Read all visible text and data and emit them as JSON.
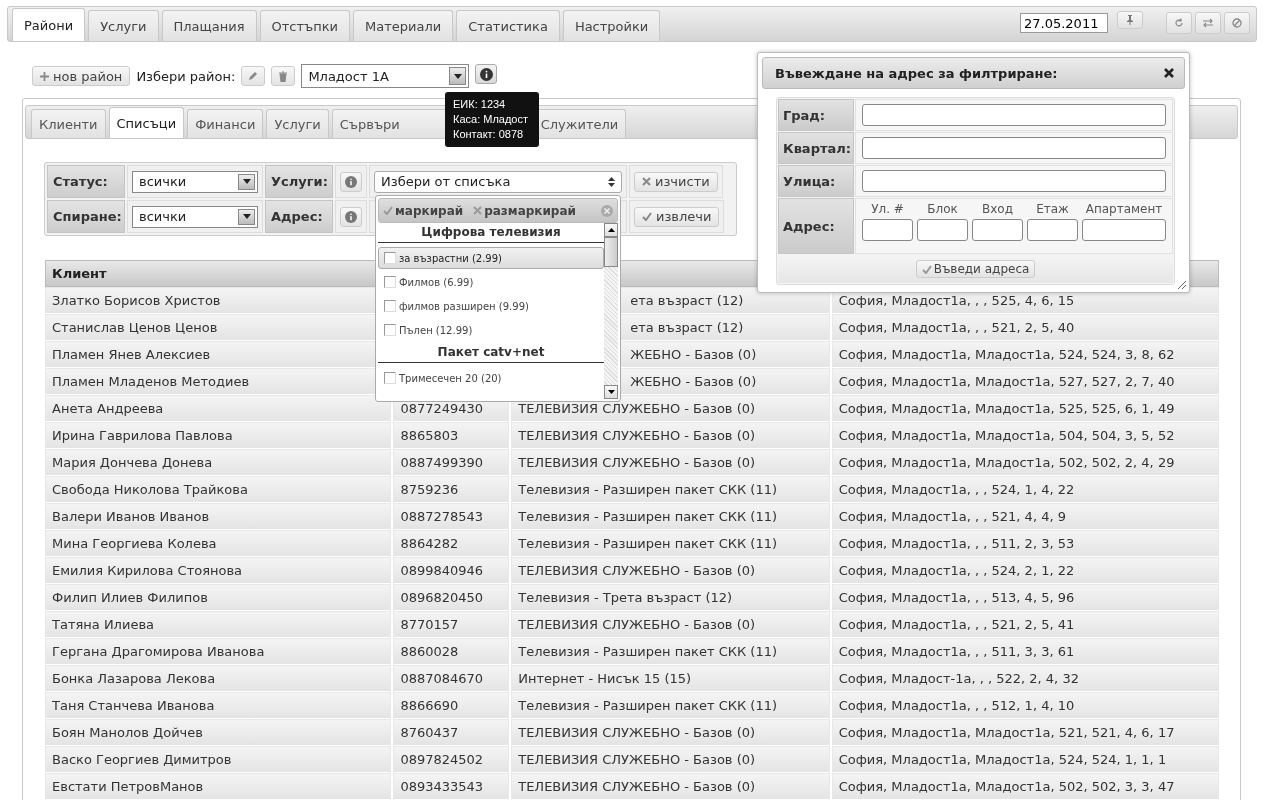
{
  "main_tabs": [
    {
      "label": "Райони",
      "selected": true
    },
    {
      "label": "Услуги",
      "selected": false
    },
    {
      "label": "Плащания",
      "selected": false
    },
    {
      "label": "Отстъпки",
      "selected": false
    },
    {
      "label": "Материали",
      "selected": false
    },
    {
      "label": "Статистика",
      "selected": false
    },
    {
      "label": "Настройки",
      "selected": false
    }
  ],
  "date": "27.05.2011",
  "district_bar": {
    "new_button": "нов район",
    "label": "Избери район:",
    "value": "Младост 1А"
  },
  "tooltip": [
    "ЕИК: 1234",
    "Каса: Младост",
    "Контакт: 0878"
  ],
  "sub_tabs": [
    {
      "label": "Клиенти",
      "selected": false
    },
    {
      "label": "Списъци",
      "selected": true
    },
    {
      "label": "Финанси",
      "selected": false
    },
    {
      "label": "Услуги",
      "selected": false
    },
    {
      "label": "Сървъри",
      "selected": false
    },
    {
      "label": "Служители",
      "selected": false
    }
  ],
  "filters": {
    "status_label": "Статус:",
    "status_value": "всички",
    "stop_label": "Спиране:",
    "stop_value": "всички",
    "services_label": "Услуги:",
    "services_value": "Избери от списъка",
    "address_label": "Адрес:",
    "clear_button": "изчисти",
    "extract_button": "извлечи"
  },
  "services_dropdown": {
    "mark": "маркирай",
    "unmark": "размаркирай",
    "items": [
      {
        "kind": "group",
        "label": "Цифрова телевизия"
      },
      {
        "kind": "option",
        "label": "за възрастни (2.99)",
        "checked": false,
        "focused": true
      },
      {
        "kind": "option",
        "label": "Филмов (6.99)",
        "checked": false,
        "focused": false
      },
      {
        "kind": "option",
        "label": "филмов разширен (9.99)",
        "checked": false,
        "focused": false
      },
      {
        "kind": "option",
        "label": "Пълен (12.99)",
        "checked": false,
        "focused": false
      },
      {
        "kind": "group",
        "label": "Пакет catv+net"
      },
      {
        "kind": "option",
        "label": "Тримесечен 20 (20)",
        "checked": false,
        "focused": false
      }
    ]
  },
  "address_dialog": {
    "title": "Въвеждане на адрес за филтриране:",
    "city_label": "Град:",
    "quarter_label": "Квартал:",
    "street_label": "Улица:",
    "address_label": "Адрес:",
    "parts": [
      "Ул. #",
      "Блок",
      "Вход",
      "Етаж",
      "Апартамент"
    ],
    "submit": "Въведи адреса"
  },
  "table": {
    "columns": [
      "Клиент"
    ],
    "rows": [
      {
        "name": "Златко Борисов Христов",
        "service": "ета възраст (12)",
        "service_cut": true,
        "address": "София, Младост1а, , , 525, 4, 6, 15"
      },
      {
        "name": "Станислав Ценов Ценов",
        "service": "ета възраст (12)",
        "service_cut": true,
        "address": "София, Младост1а, , , 521, 2, 5, 40"
      },
      {
        "name": "Пламен Янев Алексиев",
        "service": "ЖЕБНО - Базов (0)",
        "service_cut": true,
        "address": "София, Младост1а, Младост1а, 524, 524, 3, 8, 62"
      },
      {
        "name": "Пламен Младенов Методиев",
        "service": "ЖЕБНО - Базов (0)",
        "service_cut": true,
        "address": "София, Младост1а, Младост1а, 527, 527, 2, 7, 40"
      },
      {
        "name": "Анета Андреева",
        "phone": "0877249430",
        "service": "ТЕЛЕВИЗИЯ СЛУЖЕБНО - Базов (0)",
        "service_cut": false,
        "address": "София, Младост1а, Младост1а, 525, 525, 6, 1, 49"
      },
      {
        "name": "Ирина Гаврилова Павлова",
        "phone": "8865803",
        "service": "ТЕЛЕВИЗИЯ СЛУЖЕБНО - Базов (0)",
        "service_cut": false,
        "address": "София, Младост1а, Младост1а, 504, 504, 3, 5, 52"
      },
      {
        "name": "Мария Дончева Донева",
        "phone": "0887499390",
        "service": "ТЕЛЕВИЗИЯ СЛУЖЕБНО - Базов (0)",
        "service_cut": false,
        "address": "София, Младост1а, Младост1а, 502, 502, 2, 4, 29"
      },
      {
        "name": "Свобода Николова Трайкова",
        "phone": "8759236",
        "service": "Телевизия - Разширен пакет СКК (11)",
        "service_cut": false,
        "address": "София, Младост1а, , , 524, 1, 4, 22"
      },
      {
        "name": "Валери Иванов Иванов",
        "phone": "0887278543",
        "service": "Телевизия - Разширен пакет СКК (11)",
        "service_cut": false,
        "address": "София, Младост1а, , , 521, 4, 4, 9"
      },
      {
        "name": "Мина Георгиева Колева",
        "phone": "8864282",
        "service": "Телевизия - Разширен пакет СКК (11)",
        "service_cut": false,
        "address": "София, Младост1а, , , 511, 2, 3, 53"
      },
      {
        "name": "Емилия Кирилова Стоянова",
        "phone": "0899840946",
        "service": "ТЕЛЕВИЗИЯ СЛУЖЕБНО - Базов (0)",
        "service_cut": false,
        "address": "София, Младост1а, , , 524, 2, 1, 22"
      },
      {
        "name": "Филип Илиев Филипов",
        "phone": "0896820450",
        "service": "Телевизия - Трета възраст (12)",
        "service_cut": false,
        "address": "София, Младост1а, , , 513, 4, 5, 96"
      },
      {
        "name": "Татяна Илиева",
        "phone": "8770157",
        "service": "ТЕЛЕВИЗИЯ СЛУЖЕБНО - Базов (0)",
        "service_cut": false,
        "address": "София, Младост1а, , , 521, 2, 5, 41"
      },
      {
        "name": "Гергана Драгомирова Иванова",
        "phone": "8860028",
        "service": "Телевизия - Разширен пакет СКК (11)",
        "service_cut": false,
        "address": "София, Младост1а, , , 511, 3, 3, 61"
      },
      {
        "name": "Бонка Лазарова Лекова",
        "phone": "0887084670",
        "service": "Интернет - Нисък 15 (15)",
        "service_cut": false,
        "address": "София, Младост-1а, , , 522, 2, 4, 32"
      },
      {
        "name": "Таня Станчева Иванова",
        "phone": "8866690",
        "service": "Телевизия - Разширен пакет СКК (11)",
        "service_cut": false,
        "address": "София, Младост1а, , , 512, 1, 4, 10"
      },
      {
        "name": "Боян Манолов Дойчев",
        "phone": "8760437",
        "service": "ТЕЛЕВИЗИЯ СЛУЖЕБНО - Базов (0)",
        "service_cut": false,
        "address": "София, Младост1а, Младост1а, 521, 521, 4, 6, 17"
      },
      {
        "name": "Васко Георгиев Димитров",
        "phone": "0897824502",
        "service": "ТЕЛЕВИЗИЯ СЛУЖЕБНО - Базов (0)",
        "service_cut": false,
        "address": "София, Младост1а, Младост1а, 524, 524, 1, 1, 1"
      },
      {
        "name": "Евстати ПетровМанов",
        "phone": "0893433543",
        "service": "ТЕЛЕВИЗИЯ СЛУЖЕБНО - Базов (0)",
        "service_cut": false,
        "address": "София, Младост1а, Младост1а, 502, 502, 3, 3, 47"
      }
    ]
  }
}
